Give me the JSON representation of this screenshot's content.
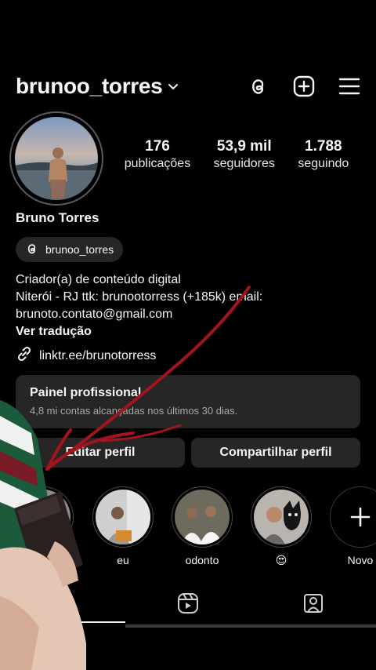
{
  "header": {
    "username": "brunoo_torres",
    "icons": [
      "chevron-down-icon",
      "threads-icon",
      "new-post-icon",
      "menu-icon"
    ]
  },
  "profile": {
    "stats": [
      {
        "value": "176",
        "label": "publicações"
      },
      {
        "value": "53,9 mil",
        "label": "seguidores"
      },
      {
        "value": "1.788",
        "label": "seguindo"
      }
    ],
    "full_name": "Bruno Torres",
    "threads_handle": "brunoo_torres",
    "bio": {
      "line1": "Criador(a) de conteúdo digital",
      "line2": "Niterói - RJ ttk: brunootorress (+185k) email:",
      "line3": "brunoto.contato@gmail.com",
      "translate": "Ver tradução"
    },
    "link": "linktr.ee/brunotorress"
  },
  "panel": {
    "title": "Painel profissional",
    "subtitle": "4,8 mi contas alcançadas nos últimos 30 dias."
  },
  "buttons": {
    "edit": "Editar perfil",
    "share": "Compartilhar perfil"
  },
  "highlights": [
    {
      "label": ""
    },
    {
      "label": "eu"
    },
    {
      "label": "odonto"
    },
    {
      "label": "😍"
    },
    {
      "label": "Novo"
    }
  ],
  "tabs": [
    "grid-icon",
    "reels-icon",
    "tagged-icon"
  ],
  "colors": {
    "background": "#000000",
    "surface": "#262626",
    "text": "#f5f5f5",
    "muted": "#a8a8a8",
    "annotation": "#a3141c"
  }
}
